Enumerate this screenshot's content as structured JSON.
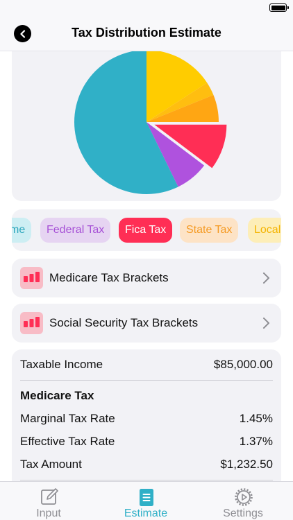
{
  "nav": {
    "title": "Tax Distribution Estimate"
  },
  "chart_data": {
    "type": "pie",
    "unit": "degrees",
    "slices": [
      {
        "name": "Federal Tax (main)",
        "start": 0,
        "end": 57,
        "color": "#ffcc00"
      },
      {
        "name": "Federal Tax (band 2)",
        "start": 57,
        "end": 68,
        "color": "#ffbe10"
      },
      {
        "name": "Federal Tax (band 3)",
        "start": 68,
        "end": 90,
        "color": "#ffa613"
      },
      {
        "name": "Fica Tax",
        "start": 90,
        "end": 127,
        "color": "#ff2e55",
        "offset": 12
      },
      {
        "name": "State Tax",
        "start": 127,
        "end": 154,
        "color": "#af52de"
      },
      {
        "name": "Remainder",
        "start": 154,
        "end": 360,
        "color": "#30b0c7"
      }
    ]
  },
  "chips": [
    {
      "label": "me",
      "bg": "#cdeef3",
      "fg": "#2fa7bd"
    },
    {
      "label": "Federal Tax",
      "bg": "#e6d4f2",
      "fg": "#a650d6"
    },
    {
      "label": "Fica Tax",
      "bg": "#ff2e55",
      "fg": "#ffffff"
    },
    {
      "label": "State Tax",
      "bg": "#fde3c6",
      "fg": "#f59a23"
    },
    {
      "label": "Local",
      "bg": "#fdeeb8",
      "fg": "#f4b400"
    }
  ],
  "links": {
    "medicare": {
      "label": "Medicare Tax Brackets",
      "icon": "bar-chart-icon"
    },
    "social_security": {
      "label": "Social Security Tax Brackets",
      "icon": "bar-chart-icon"
    }
  },
  "details": {
    "taxable_income_label": "Taxable Income",
    "taxable_income_value": "$85,000.00",
    "section_title": "Medicare Tax",
    "marginal_label": "Marginal Tax Rate",
    "marginal_value": "1.45%",
    "effective_label": "Effective Tax Rate",
    "effective_value": "1.37%",
    "amount_label": "Tax Amount",
    "amount_value": "$1,232.50"
  },
  "tabs": [
    {
      "label": "Input",
      "icon": "edit-icon",
      "active": false
    },
    {
      "label": "Estimate",
      "icon": "document-icon",
      "active": true
    },
    {
      "label": "Settings",
      "icon": "gear-icon",
      "active": false
    }
  ],
  "colors": {
    "accent": "#30b0c7",
    "inactive": "#8e8e93"
  }
}
